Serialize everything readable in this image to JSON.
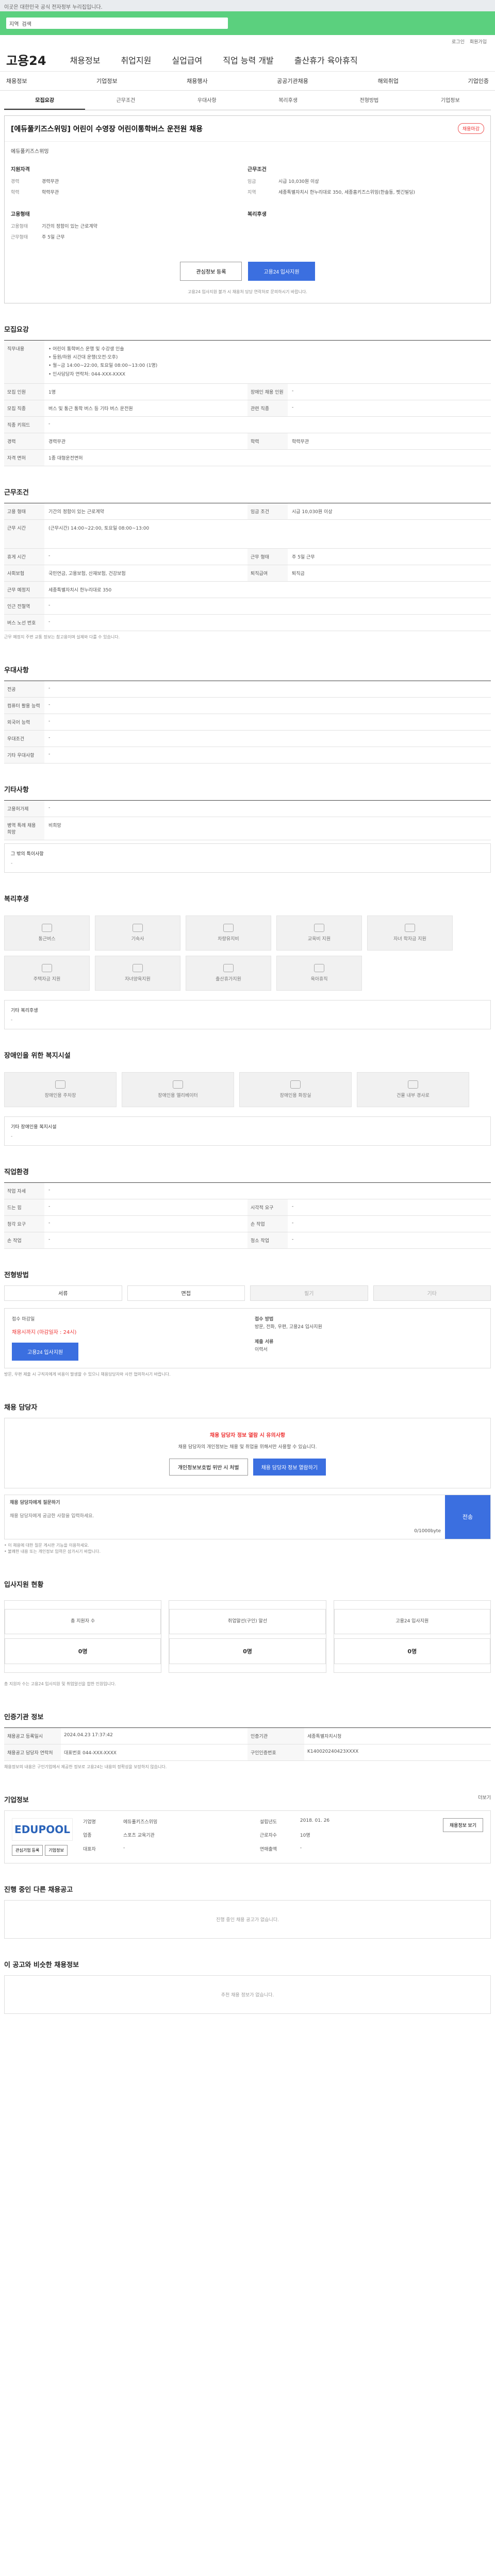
{
  "top": {
    "notice": "이곳은 대한민국 공식 전자정부 누리집입니다."
  },
  "search": {
    "label": "지역",
    "placeholder": "검색"
  },
  "util": [
    "로그인",
    "회원가입"
  ],
  "brand": {
    "logo": "고용24"
  },
  "gnb": [
    "채용정보",
    "취업지원",
    "실업급여",
    "직업 능력 개발",
    "출산휴가 육아휴직"
  ],
  "lnb": [
    "채용정보",
    "기업정보",
    "채용행사",
    "공공기관채용",
    "해외취업",
    "기업인증"
  ],
  "tabs": [
    "모집요강",
    "근무조건",
    "우대사항",
    "복리후생",
    "전형방법",
    "기업정보"
  ],
  "job": {
    "title": "[에듀풀키즈스위밍] 어린이 수영장 어린이통학버스 운전원 채용",
    "badge": "채용마감",
    "company": "에듀풀키즈스위밍",
    "left_head": "지원자격",
    "left": [
      {
        "k": "경력",
        "v": "경력무관"
      },
      {
        "k": "학력",
        "v": "학력무관"
      }
    ],
    "right_head": "근무조건",
    "right": [
      {
        "k": "임금",
        "v": "시급 10,030원 이상"
      },
      {
        "k": "지역",
        "v": "세종특별자치시 한누리대로 350, 세종홈키즈스위밍(한솔동, 펫긴빌딩)"
      }
    ],
    "left2_head": "고용형태",
    "left2": [
      {
        "k": "고용형태",
        "v": "기간의 정함이 있는 근로계약"
      },
      {
        "k": "근무형태",
        "v": "주 5일 근무"
      }
    ],
    "right2_head": "복리후생",
    "btn_interest": "관심정보 등록",
    "btn_apply": "고용24 입사지원",
    "note": "고용24 입사지원 불가 시 채용처 담당 연락처로 문의하시기 바랍니다."
  },
  "recruit": {
    "head": "모집요강",
    "duty_head": "직무내용",
    "duty": "• 어린이 통학버스 운행 및 수강생 인솔\n• 등원/하원 시간대 운행(오전·오후)\n• 월~금 14:00~22:00, 토요일 08:00~13:00 (1명)\n• 인사담당자 연락처: 044-XXX-XXXX",
    "rows": [
      [
        {
          "k": "모집 인원",
          "v": "1명"
        },
        {
          "k": "장애인 채용 인원",
          "v": "-"
        }
      ],
      [
        {
          "k": "모집 직종",
          "v": "버스 및 통근 통학 버스 등 기타 버스 운전원"
        },
        {
          "k": "관련 직종",
          "v": "-"
        }
      ],
      [
        {
          "k": "직종 키워드",
          "v": "-"
        },
        {
          "k": "",
          "v": ""
        }
      ],
      [
        {
          "k": "경력",
          "v": "경력무관"
        },
        {
          "k": "학력",
          "v": "학력무관"
        }
      ],
      [
        {
          "k": "자격 면허",
          "v": "1종 대형운전면허"
        },
        {
          "k": "",
          "v": ""
        }
      ]
    ]
  },
  "work": {
    "head": "근무조건",
    "rows": [
      [
        {
          "k": "고용 형태",
          "v": "기간의 정함이 있는 근로계약"
        },
        {
          "k": "임금 조건",
          "v": "시급 10,030원 이상"
        }
      ],
      [
        {
          "k": "근무 시간",
          "v": "(근무시간) 14:00~22:00, 토요일 08:00~13:00"
        },
        {
          "k": "",
          "v": ""
        }
      ],
      [
        {
          "k": "휴게 시간",
          "v": "-"
        },
        {
          "k": "근무 형태",
          "v": "주 5일 근무"
        }
      ],
      [
        {
          "k": "사회보험",
          "v": "국민연금, 고용보험, 산재보험, 건강보험"
        },
        {
          "k": "퇴직급여",
          "v": "퇴직금"
        }
      ],
      [
        {
          "k": "근무 예정지",
          "v": "세종특별자치시 한누리대로 350"
        },
        {
          "k": "",
          "v": ""
        }
      ],
      [
        {
          "k": "인근 전철역",
          "v": "-"
        },
        {
          "k": "",
          "v": ""
        }
      ],
      [
        {
          "k": "버스 노선 번호",
          "v": "-"
        },
        {
          "k": "",
          "v": ""
        }
      ]
    ],
    "note": "근무 예정지 주변 교통 정보는 참고용이며 실제와 다를 수 있습니다."
  },
  "prefer": {
    "head": "우대사항",
    "rows": [
      {
        "k": "전공",
        "v": "-"
      },
      {
        "k": "컴퓨터 활용 능력",
        "v": "-"
      },
      {
        "k": "외국어 능력",
        "v": "-"
      },
      {
        "k": "우대조건",
        "v": "-"
      },
      {
        "k": "기타 우대사항",
        "v": "-"
      }
    ]
  },
  "other": {
    "head": "기타사항",
    "rows": [
      {
        "k": "고용허가제",
        "v": "-"
      },
      {
        "k": "병역 특례 채용 희망",
        "v": "비희망"
      }
    ],
    "sub_title": "그 밖의 특이사항",
    "sub_value": "-"
  },
  "welfare": {
    "head": "복리후생",
    "tiles": [
      "통근버스",
      "기숙사",
      "차량유지비",
      "교육비 지원",
      "자녀 학자금 지원",
      "주택자금 지원",
      "자녀양육지원",
      "출산휴가지원",
      "육아휴직"
    ],
    "sub_title": "기타 복리후생",
    "sub_value": "-"
  },
  "disabled": {
    "head": "장애인을 위한 복지시설",
    "tiles": [
      "장애인용 주차장",
      "장애인용 엘리베이터",
      "장애인용 화장실",
      "건물 내부 경사로"
    ],
    "sub_title": "기타 장애인용 복지시설",
    "sub_value": "-"
  },
  "docs": {
    "head": "직업환경",
    "rows": [
      [
        {
          "k": "작업 자세",
          "v": "-"
        },
        {
          "k": "",
          "v": ""
        }
      ],
      [
        {
          "k": "드는 힘",
          "v": "-"
        },
        {
          "k": "시각적 요구",
          "v": "-"
        }
      ],
      [
        {
          "k": "청각 요구",
          "v": "-"
        },
        {
          "k": "손 작업",
          "v": "-"
        }
      ],
      [
        {
          "k": "손 작업",
          "v": "-"
        },
        {
          "k": "청소 작업",
          "v": "-"
        }
      ]
    ]
  },
  "screening": {
    "head": "전형방법",
    "methods": [
      {
        "label": "서류",
        "off": false
      },
      {
        "label": "면접",
        "off": false
      },
      {
        "label": "필기",
        "off": true
      },
      {
        "label": "기타",
        "off": true
      }
    ],
    "deadline_head": "접수 마감일",
    "deadline": "채용시까지 (마감일자 : 24시)",
    "apply_btn": "고용24 입사지원",
    "method_head": "접수 방법",
    "method_val": "방문, 전화, 우편, 고용24 입사지원",
    "doc_head": "제출 서류",
    "doc_val": "이력서",
    "note": "방문, 우편 제출 시 구직자에게 비용이 발생할 수 있으니 채용담당자와 사전 협의하시기 바랍니다."
  },
  "manager": {
    "head": "채용 담당자",
    "warn": "채용 담당자 정보 열람 시 유의사항",
    "text": "채용 담당자의 개인정보는 채용 및 취업을 위해서만 사용할 수 있습니다.",
    "btn1": "개인정보보호법 위반 시 처벌",
    "btn2": "채용 담당자 정보 열람하기",
    "q_head": "채용 담당자에게 질문하기",
    "q_placeholder": "채용 담당자에게 궁금한 사항을 입력하세요.",
    "q_btn": "전송",
    "q_count": "0/1000byte",
    "notes": [
      "• 이 채용에 대한 질문 게시판 기능을 이용하세요.",
      "• 불쾌한 내용 또는 개인정보 입력은 삼가시기 바랍니다."
    ]
  },
  "stats": {
    "head": "입사지원 현황",
    "items": [
      {
        "k": "총 지원자 수",
        "v": "0명"
      },
      {
        "k": "취업알선(구인) 알선",
        "v": "0명"
      },
      {
        "k": "고용24 입사지원",
        "v": "0명"
      }
    ],
    "note": "총 지원자 수는 고용24 입사지원 및 취업알선을 합한 인원입니다."
  },
  "certinfo": {
    "head": "인증기관 정보",
    "rows": [
      {
        "k": "채용공고 등록일시",
        "v": "2024.04.23 17:37:42"
      },
      {
        "k": "인증기관",
        "v": "세종특별자치시청"
      },
      {
        "k": "채용공고 담당자 연락처",
        "v": "대표번호 044-XXX-XXXX"
      },
      {
        "k": "구인인증번호",
        "v": "K140020240423XXXX"
      }
    ],
    "note": "채용정보의 내용은 구인기업에서 제공한 정보로 고용24는 내용의 정확성을 보장하지 않습니다."
  },
  "corp": {
    "head": "기업정보",
    "more": "더보기",
    "logo": "EDUPOOL",
    "btn1": "관심기업 등록",
    "btn2": "기업정보",
    "meta": [
      {
        "k": "기업명",
        "v": "에듀풀키즈스위밍"
      },
      {
        "k": "업종",
        "v": "스포츠 교육기관"
      },
      {
        "k": "대표자",
        "v": "-"
      },
      {
        "k": "설립년도",
        "v": "2018. 01. 26"
      },
      {
        "k": "근로자수",
        "v": "10명"
      },
      {
        "k": "연매출액",
        "v": "-"
      }
    ],
    "btn3": "채용정보 보기"
  },
  "more_jobs": {
    "head": "진행 중인 다른 채용공고",
    "empty": "진행 중인 채용 공고가 없습니다."
  },
  "similar": {
    "head": "이 공고와 비슷한 채용정보",
    "empty": "추천 채용 정보가 없습니다."
  }
}
